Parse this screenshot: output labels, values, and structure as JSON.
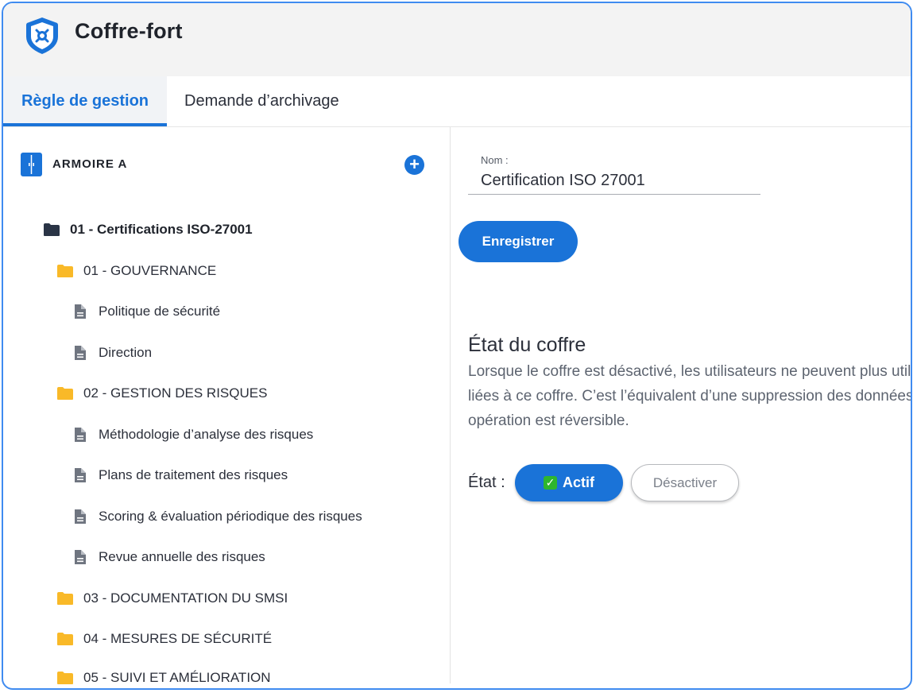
{
  "app": {
    "title": "Coffre-fort"
  },
  "tabs": [
    {
      "label": "Règle de gestion",
      "active": true
    },
    {
      "label": "Demande d’archivage",
      "active": false
    }
  ],
  "sidebar": {
    "cabinet_label": "ARMOIRE A",
    "add_label": "+",
    "tree": [
      {
        "label": "01 - Certifications ISO-27001",
        "type": "folder-dark",
        "level": 0
      },
      {
        "label": "01 - GOUVERNANCE",
        "type": "folder",
        "level": 1
      },
      {
        "label": "Politique de sécurité",
        "type": "document",
        "level": 2
      },
      {
        "label": "Direction",
        "type": "document",
        "level": 2
      },
      {
        "label": "02 - GESTION DES RISQUES",
        "type": "folder",
        "level": 1
      },
      {
        "label": "Méthodologie d’analyse des risques",
        "type": "document",
        "level": 2
      },
      {
        "label": "Plans de traitement des risques",
        "type": "document",
        "level": 2
      },
      {
        "label": "Scoring & évaluation périodique des risques",
        "type": "document",
        "level": 2
      },
      {
        "label": "Revue annuelle des risques",
        "type": "document",
        "level": 2
      },
      {
        "label": "03 - DOCUMENTATION DU SMSI",
        "type": "folder",
        "level": 1
      },
      {
        "label": "04 - MESURES DE SÉCURITÉ",
        "type": "folder",
        "level": 1
      },
      {
        "label": "05 - SUIVI ET AMÉLIORATION",
        "type": "folder",
        "level": 1
      }
    ]
  },
  "form": {
    "name_label": "Nom :",
    "name_value": "Certification ISO 27001",
    "save_label": "Enregistrer"
  },
  "state": {
    "title": "État du coffre",
    "description": "Lorsque le coffre est désactivé, les utilisateurs ne peuvent plus utiliser les fonctions liées à ce coffre. C’est l’équivalent d’une suppression des données. Cette opération est réversible.",
    "label": "État :",
    "active_label": "Actif",
    "deactivate_label": "Désactiver"
  },
  "colors": {
    "accent": "#1a73d8",
    "folder": "#f9b928",
    "frame": "#3f8bf0"
  }
}
